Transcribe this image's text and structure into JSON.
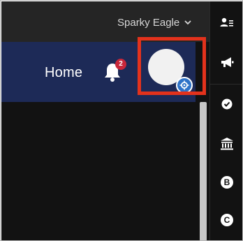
{
  "topbar": {
    "user_name": "Sparky Eagle"
  },
  "navbar": {
    "home_label": "Home",
    "notification_count": "2"
  },
  "rail": {
    "items": [
      {
        "icon": "person-list-icon"
      },
      {
        "icon": "megaphone-icon"
      },
      {
        "icon": "check-circle-icon"
      },
      {
        "icon": "bank-icon"
      },
      {
        "icon": "letter-b-icon",
        "letter": "B"
      },
      {
        "icon": "letter-c-icon",
        "letter": "C"
      }
    ]
  },
  "colors": {
    "navbar": "#1d2a57",
    "highlight": "#e3321c",
    "badge": "#c9273a",
    "gear": "#2e73c8"
  }
}
